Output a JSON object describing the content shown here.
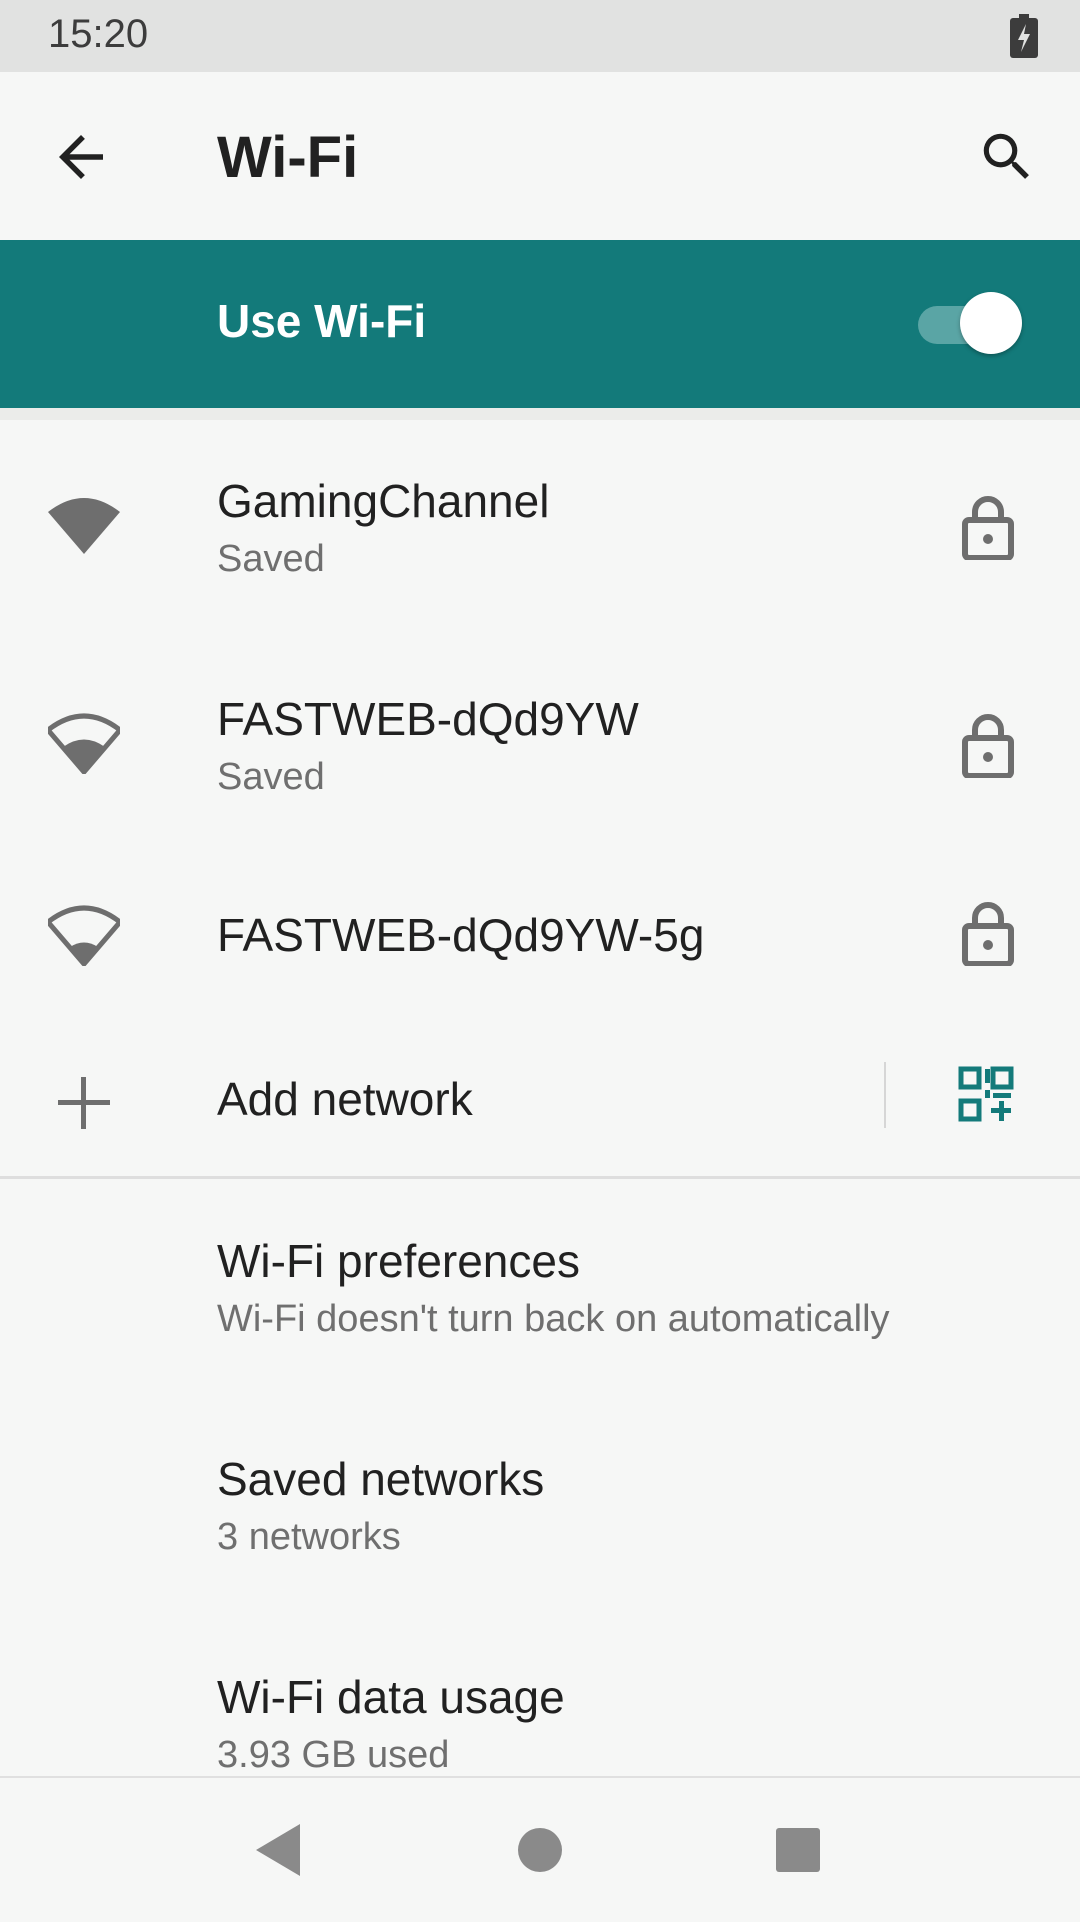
{
  "status_bar": {
    "time": "15:20",
    "battery_icon": "battery-charging-icon"
  },
  "app_bar": {
    "title": "Wi-Fi",
    "back_icon": "arrow-back-icon",
    "search_icon": "search-icon"
  },
  "master_switch": {
    "label": "Use Wi-Fi",
    "enabled": true
  },
  "networks": [
    {
      "ssid": "GamingChannel",
      "status": "Saved",
      "signal_icon": "wifi-signal-full-icon",
      "secured": true
    },
    {
      "ssid": "FASTWEB-dQd9YW",
      "status": "Saved",
      "signal_icon": "wifi-signal-medium-icon",
      "secured": true
    },
    {
      "ssid": "FASTWEB-dQd9YW-5g",
      "status": "",
      "signal_icon": "wifi-signal-low-icon",
      "secured": true
    }
  ],
  "add_network": {
    "label": "Add network",
    "plus_icon": "plus-icon",
    "qr_icon": "qr-code-scan-icon"
  },
  "preferences": [
    {
      "title": "Wi-Fi preferences",
      "subtitle": "Wi-Fi doesn't turn back on automatically"
    },
    {
      "title": "Saved networks",
      "subtitle": "3 networks"
    },
    {
      "title": "Wi-Fi data usage",
      "subtitle": "3.93 GB used"
    }
  ],
  "colors": {
    "accent": "#137a7a",
    "toggle_track": "#5aa5a5",
    "icon_gray": "#6e6e6e"
  }
}
